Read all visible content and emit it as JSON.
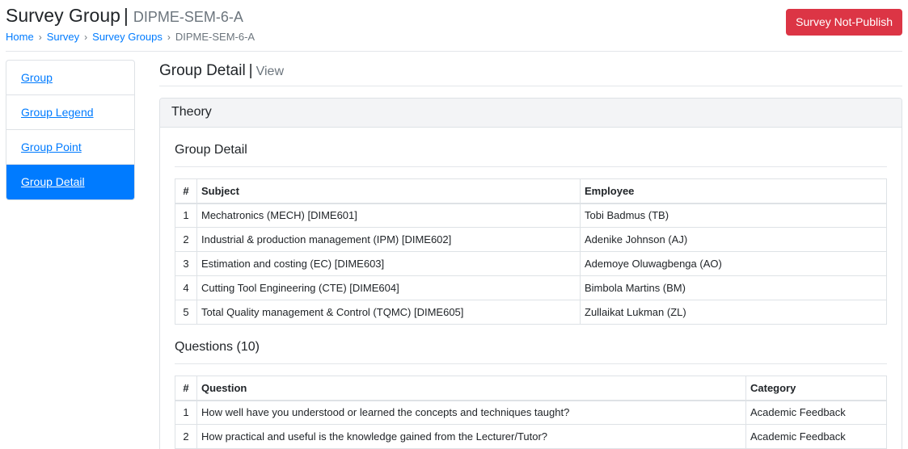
{
  "header": {
    "title": "Survey Group",
    "separator": "|",
    "subtitle": "DIPME-SEM-6-A",
    "publish_button": "Survey Not-Publish"
  },
  "breadcrumb": {
    "items": [
      "Home",
      "Survey",
      "Survey Groups"
    ],
    "current": "DIPME-SEM-6-A",
    "separator": "›"
  },
  "sidebar": {
    "items": [
      {
        "label": "Group"
      },
      {
        "label": "Group Legend"
      },
      {
        "label": "Group Point"
      },
      {
        "label": "Group Detail"
      }
    ],
    "active_index": 3
  },
  "section": {
    "title": "Group Detail",
    "separator": "|",
    "subtitle": "View"
  },
  "card": {
    "title": "Theory",
    "group_detail": {
      "title": "Group Detail",
      "headers": [
        "#",
        "Subject",
        "Employee"
      ],
      "rows": [
        [
          "1",
          "Mechatronics (MECH) [DIME601]",
          "Tobi Badmus (TB)"
        ],
        [
          "2",
          "Industrial & production management (IPM) [DIME602]",
          "Adenike Johnson (AJ)"
        ],
        [
          "3",
          "Estimation and costing (EC) [DIME603]",
          "Ademoye Oluwagbenga (AO)"
        ],
        [
          "4",
          "Cutting Tool Engineering (CTE) [DIME604]",
          "Bimbola Martins (BM)"
        ],
        [
          "5",
          "Total Quality management & Control (TQMC) [DIME605]",
          "Zullaikat Lukman (ZL)"
        ]
      ]
    },
    "questions": {
      "title": "Questions (10)",
      "headers": [
        "#",
        "Question",
        "Category"
      ],
      "rows": [
        [
          "1",
          "How well have you understood or learned the concepts and techniques taught?",
          "Academic Feedback"
        ],
        [
          "2",
          "How practical and useful is the knowledge gained from the Lecturer/Tutor?",
          "Academic Feedback"
        ]
      ]
    }
  },
  "colors": {
    "primary": "#007bff",
    "danger": "#dc3545",
    "muted": "#6c757d"
  }
}
